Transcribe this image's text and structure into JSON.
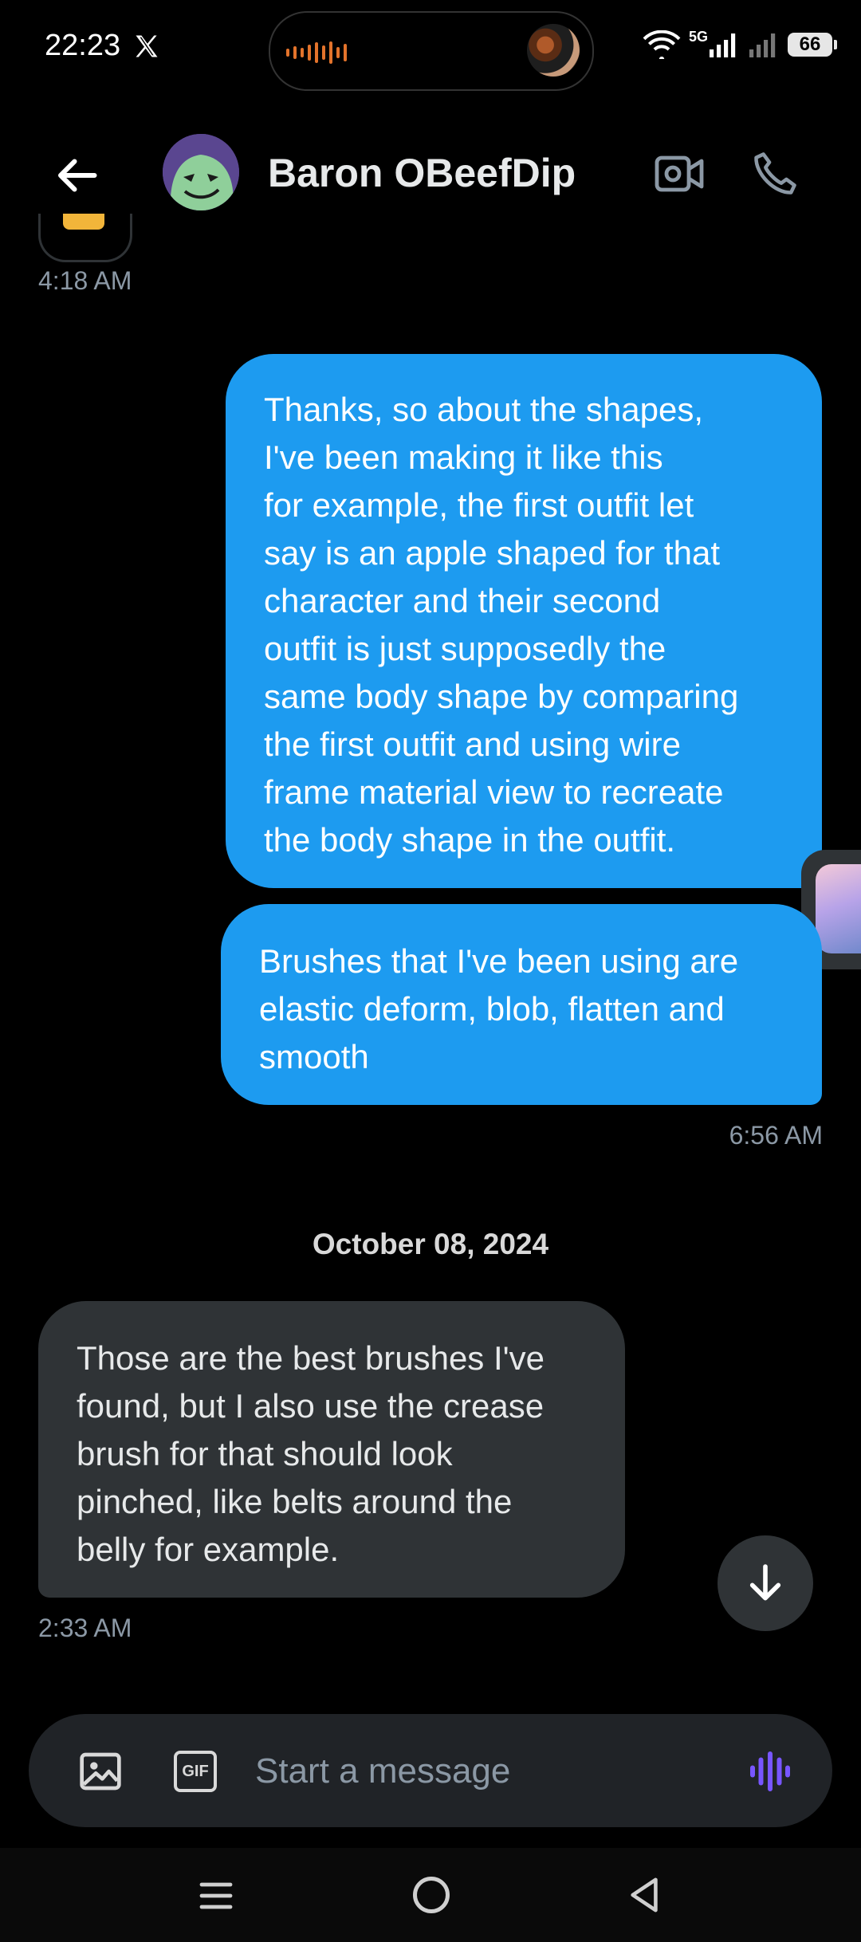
{
  "status_bar": {
    "time": "22:23",
    "network": "5G",
    "battery": "66"
  },
  "header": {
    "contact_name": "Baron OBeefDip"
  },
  "messages": [
    {
      "direction": "in",
      "timestamp": "4:18 AM"
    },
    {
      "direction": "out",
      "lines": [
        "Thanks, so about the shapes,",
        "I've been making it like this",
        "for example, the first outfit let",
        "say is an apple shaped for that",
        "character and their second",
        "outfit is just supposedly the",
        "same body shape by comparing",
        "the first outfit and using wire",
        "frame material view to recreate",
        "the body shape in the outfit."
      ]
    },
    {
      "direction": "out",
      "lines": [
        "Brushes that I've been using are",
        "elastic deform, blob, flatten and",
        "smooth"
      ],
      "timestamp": "6:56 AM"
    },
    {
      "direction": "in",
      "lines": [
        "Those are the best brushes I've",
        "found, but I also use the crease",
        "brush for that should look",
        "pinched, like belts around the",
        "belly for example."
      ],
      "timestamp": "2:33 AM"
    }
  ],
  "date_separator": "October 08, 2024",
  "composer": {
    "gif_label": "GIF",
    "placeholder": "Start a message"
  },
  "colors": {
    "outgoing_bubble": "#1d9bf0",
    "incoming_bubble": "#2f3336",
    "voice_accent": "#7856ff"
  }
}
